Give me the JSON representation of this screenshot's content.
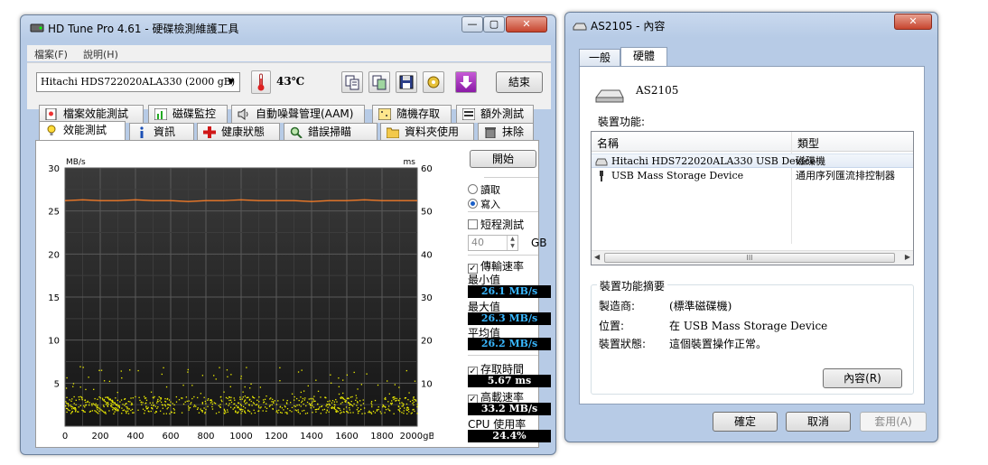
{
  "hdtune": {
    "title": "HD Tune Pro 4.61 - 硬碟檢測維護工具",
    "menu": [
      "檔案(F)",
      "說明(H)"
    ],
    "drive": "Hitachi HDS722020ALA330  (2000 gB)",
    "temperature": "43℃",
    "exit_label": "結束",
    "tabs_row1": [
      {
        "label": "檔案效能測試",
        "icon": "file-benchmark-icon"
      },
      {
        "label": "磁碟監控",
        "icon": "disk-monitor-icon"
      },
      {
        "label": "自動噪聲管理(AAM)",
        "icon": "speaker-icon"
      },
      {
        "label": "隨機存取",
        "icon": "random-access-icon"
      },
      {
        "label": "額外測試",
        "icon": "extra-tests-icon"
      }
    ],
    "tabs_row2": [
      {
        "label": "效能測試",
        "icon": "benchmark-icon"
      },
      {
        "label": "資訊",
        "icon": "info-icon"
      },
      {
        "label": "健康狀態",
        "icon": "health-cross-icon"
      },
      {
        "label": "錯誤掃瞄",
        "icon": "magnifier-icon"
      },
      {
        "label": "資料夾使用",
        "icon": "folder-icon"
      },
      {
        "label": "抹除",
        "icon": "trash-icon"
      }
    ],
    "side": {
      "start_label": "開始",
      "read_label": "讀取",
      "write_label": "寫入",
      "short_test_label": "短程測試",
      "short_test_value": "40",
      "gb_label": "GB",
      "transfer_rate_label": "傳輸速率",
      "min_label": "最小值",
      "min_value": "26.1 MB/s",
      "max_label": "最大值",
      "max_value": "26.3 MB/s",
      "avg_label": "平均值",
      "avg_value": "26.2 MB/s",
      "access_time_label": "存取時間",
      "access_time_value": "5.67 ms",
      "burst_rate_label": "高載速率",
      "burst_rate_value": "33.2 MB/s",
      "cpu_label": "CPU 使用率",
      "cpu_value": "24.4%"
    }
  },
  "chart_data": {
    "type": "line",
    "left_unit": "MB/s",
    "right_unit": "ms",
    "x_ticks": [
      "0",
      "200",
      "400",
      "600",
      "800",
      "1000",
      "1200",
      "1400",
      "1600",
      "1800",
      "2000gB"
    ],
    "y_ticks_left": [
      "5",
      "10",
      "15",
      "20",
      "25",
      "30"
    ],
    "y_ticks_right": [
      "10",
      "20",
      "30",
      "40",
      "50",
      "60"
    ],
    "xlim": [
      0,
      2000
    ],
    "ylim_left": [
      0,
      30
    ],
    "ylim_right": [
      0,
      60
    ],
    "grid": true,
    "series": [
      {
        "values_x": [
          0,
          100,
          200,
          300,
          400,
          500,
          600,
          700,
          800,
          900,
          1000,
          1100,
          1200,
          1300,
          1400,
          1500,
          1600,
          1700,
          1800,
          1900,
          2000
        ],
        "values_y": [
          26.2,
          26.3,
          26.2,
          26.2,
          26.3,
          26.2,
          26.2,
          26.1,
          26.2,
          26.2,
          26.3,
          26.2,
          26.2,
          26.2,
          26.1,
          26.2,
          26.2,
          26.3,
          26.2,
          26.2,
          26.2
        ],
        "color": "#f07a28"
      }
    ],
    "scatter": {
      "axis": "right",
      "color": "#f2f200",
      "y_range_dense": [
        3,
        7
      ],
      "y_range_sparse": [
        7,
        14
      ],
      "count": 800
    }
  },
  "props": {
    "title": "AS2105 - 內容",
    "tabs": [
      "一般",
      "硬體"
    ],
    "device_name": "AS2105",
    "functions_label": "裝置功能:",
    "col_name": "名稱",
    "col_type": "類型",
    "rows": [
      {
        "name": "Hitachi HDS722020ALA330 USB Device",
        "type": "磁碟機"
      },
      {
        "name": "USB Mass Storage Device",
        "type": "通用序列匯流排控制器"
      }
    ],
    "scroll_mark": "III",
    "summary_label": "裝置功能摘要",
    "manufacturer_key": "製造商:",
    "manufacturer_val": "(標準磁碟機)",
    "location_key": "位置:",
    "location_val": "在 USB Mass Storage Device",
    "status_key": "裝置狀態:",
    "status_val": "這個裝置操作正常。",
    "properties_btn": "內容(R)",
    "ok_btn": "確定",
    "cancel_btn": "取消",
    "apply_btn": "套用(A)"
  },
  "colors": {
    "accent_blue": "#39b7ff",
    "title_bg": "#b7cbe6",
    "chart_bg": "#222222"
  }
}
